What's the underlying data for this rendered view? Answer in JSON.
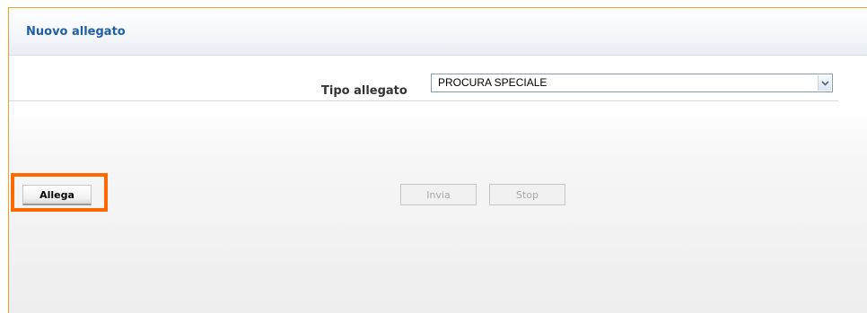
{
  "header": {
    "title": "Nuovo allegato"
  },
  "form": {
    "type_label": "Tipo allegato",
    "type_select": {
      "value": "PROCURA SPECIALE"
    }
  },
  "actions": {
    "allega_label": "Allega",
    "invia_label": "Invia",
    "stop_label": "Stop"
  },
  "colors": {
    "accent_border": "#f0a028",
    "title_text": "#1f5fa6",
    "highlight": "#ff6a00"
  },
  "icons": {
    "select_arrow": "chevron-down-icon"
  }
}
